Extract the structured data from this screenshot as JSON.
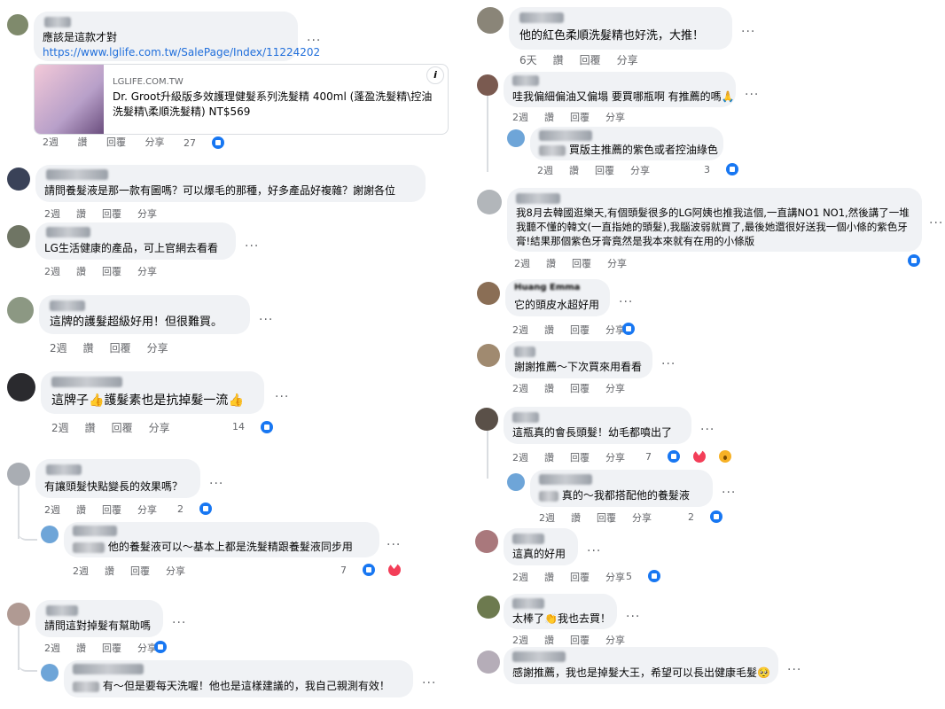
{
  "actions": {
    "time_2w": "2週",
    "time_6d": "6天",
    "like": "讚",
    "reply": "回覆",
    "share": "分享",
    "more": "..."
  },
  "left": {
    "c1": {
      "name": "詹旭",
      "text": "應該是這款才對",
      "link": "https://www.lglife.com.tw/SalePage/Index/11224202",
      "reactions": "27"
    },
    "card": {
      "domain": "LGLIFE.COM.TW",
      "title": "Dr. Groot升級版多效護理健髮系列洗髮精 400ml (蓬盈洗髮精\\控油洗髮精\\柔順洗髮精) NT$569",
      "info_icon": "i"
    },
    "c2": {
      "name": "o",
      "text": "請問養髮液是那一款有圖嗎？可以爆毛的那種，好多產品好複雜？謝謝各位"
    },
    "c3": {
      "text": "LG生活健康的產品，可上官網去看看"
    },
    "c4": {
      "text": "這牌的護髮超級好用！但很難買。"
    },
    "c5": {
      "name": "F",
      "text_a": "這牌子",
      "text_b": "護髮素也是抗掉髮一流",
      "reactions": "14"
    },
    "c6": {
      "text": "有讓頭髮快點變長的效果嗎？",
      "reactions": "2"
    },
    "r6": {
      "text": "他的養髮液可以～基本上都是洗髮精跟養髮液同步用",
      "reactions": "7"
    },
    "c7": {
      "text": "請問這對掉髮有幫助嗎"
    },
    "r7": {
      "text": "有～但是要每天洗喔！他也是這樣建議的，我自己親測有效！"
    }
  },
  "right": {
    "c1": {
      "name": "S",
      "text": "他的紅色柔順洗髮精也好洗，大推！"
    },
    "c2": {
      "text": "哇我偏細偏油又偏塌 要買哪瓶啊 有推薦的嗎",
      "pray": "🙏"
    },
    "r2": {
      "text": "買版主推薦的紫色或者控油綠色",
      "reactions": "3"
    },
    "c3": {
      "text": "我8月去韓國逛樂天,有個頭髮很多的LG阿姨也推我這個,一直講NO1 NO1,然後講了一堆我聽不懂的韓文(一直指她的頭髮),我腦波弱就買了,最後她還很好送我一個小條的紫色牙膏!結果那個紫色牙膏竟然是我本來就有在用的小條版"
    },
    "c4": {
      "name": "Huang Emma",
      "text": "它的頭皮水超好用"
    },
    "c5": {
      "text": "謝謝推薦～下次買來用看看"
    },
    "c6": {
      "text": "這瓶真的會長頭髮！幼毛都噴出了",
      "reactions": "7"
    },
    "r6": {
      "text": "真的～我都搭配他的養髮液",
      "reactions": "2"
    },
    "c7": {
      "text": "這真的好用",
      "reactions": "5"
    },
    "c8": {
      "text_a": "太棒了",
      "text_b": "我也去買！"
    },
    "c9": {
      "text": "感謝推薦，我也是掉髮大王，希望可以長出健康毛髮"
    }
  },
  "colors": {
    "link": "#216fdb",
    "bubble": "#f0f2f5",
    "like": "#1877f2",
    "love": "#f33e58",
    "meta": "#65676b"
  }
}
